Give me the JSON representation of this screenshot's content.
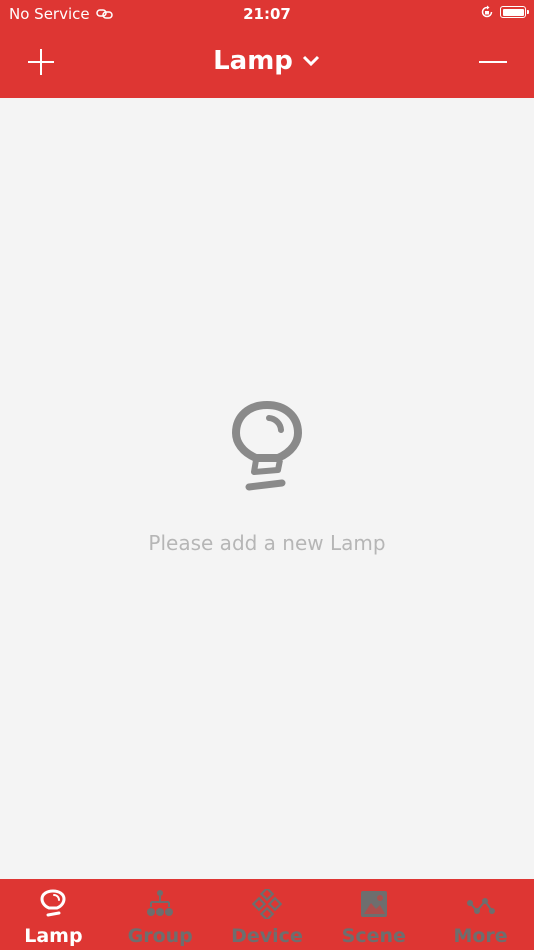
{
  "status_bar": {
    "carrier": "No Service",
    "time": "21:07"
  },
  "nav": {
    "title": "Lamp"
  },
  "empty_state": {
    "message": "Please add a new Lamp"
  },
  "tabs": [
    {
      "label": "Lamp",
      "icon": "bulb-icon",
      "active": true
    },
    {
      "label": "Group",
      "icon": "group-icon",
      "active": false
    },
    {
      "label": "Device",
      "icon": "device-icon",
      "active": false
    },
    {
      "label": "Scene",
      "icon": "scene-icon",
      "active": false
    },
    {
      "label": "More",
      "icon": "more-icon",
      "active": false
    }
  ],
  "colors": {
    "brand_red": "#de3633",
    "background": "#f4f4f4",
    "inactive_tab": "#6e6e6e",
    "placeholder_text": "#b6b6b6"
  }
}
